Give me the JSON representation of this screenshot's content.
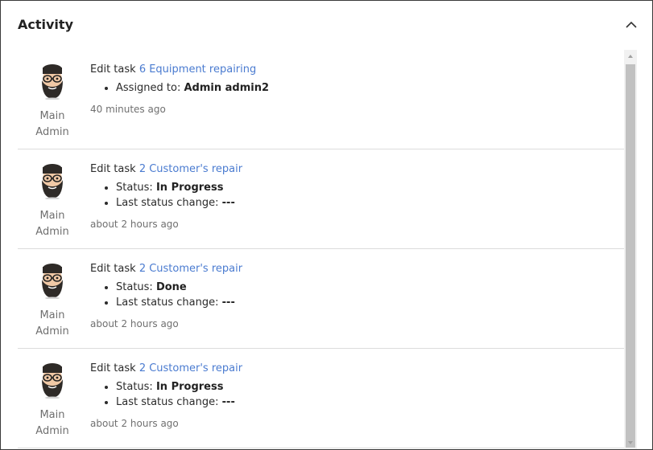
{
  "panel": {
    "title": "Activity"
  },
  "entries": [
    {
      "author_first": "Main",
      "author_last": "Admin",
      "action": "Edit task",
      "task_link": "6 Equipment repairing",
      "details": [
        {
          "label": "Assigned to:",
          "value": "Admin admin2"
        }
      ],
      "time": "40 minutes ago"
    },
    {
      "author_first": "Main",
      "author_last": "Admin",
      "action": "Edit task",
      "task_link": "2 Customer's repair",
      "details": [
        {
          "label": "Status:",
          "value": "In Progress"
        },
        {
          "label": "Last status change:",
          "value": "---"
        }
      ],
      "time": "about 2 hours ago"
    },
    {
      "author_first": "Main",
      "author_last": "Admin",
      "action": "Edit task",
      "task_link": "2 Customer's repair",
      "details": [
        {
          "label": "Status:",
          "value": "Done"
        },
        {
          "label": "Last status change:",
          "value": "---"
        }
      ],
      "time": "about 2 hours ago"
    },
    {
      "author_first": "Main",
      "author_last": "Admin",
      "action": "Edit task",
      "task_link": "2 Customer's repair",
      "details": [
        {
          "label": "Status:",
          "value": "In Progress"
        },
        {
          "label": "Last status change:",
          "value": "---"
        }
      ],
      "time": "about 2 hours ago"
    }
  ],
  "icons": {
    "collapse": "chevron-up-icon",
    "avatar": "bearded-man-avatar-icon"
  },
  "colors": {
    "link": "#4a7bd0",
    "muted": "#707070",
    "scrollbar_thumb": "#c1c1c1"
  }
}
